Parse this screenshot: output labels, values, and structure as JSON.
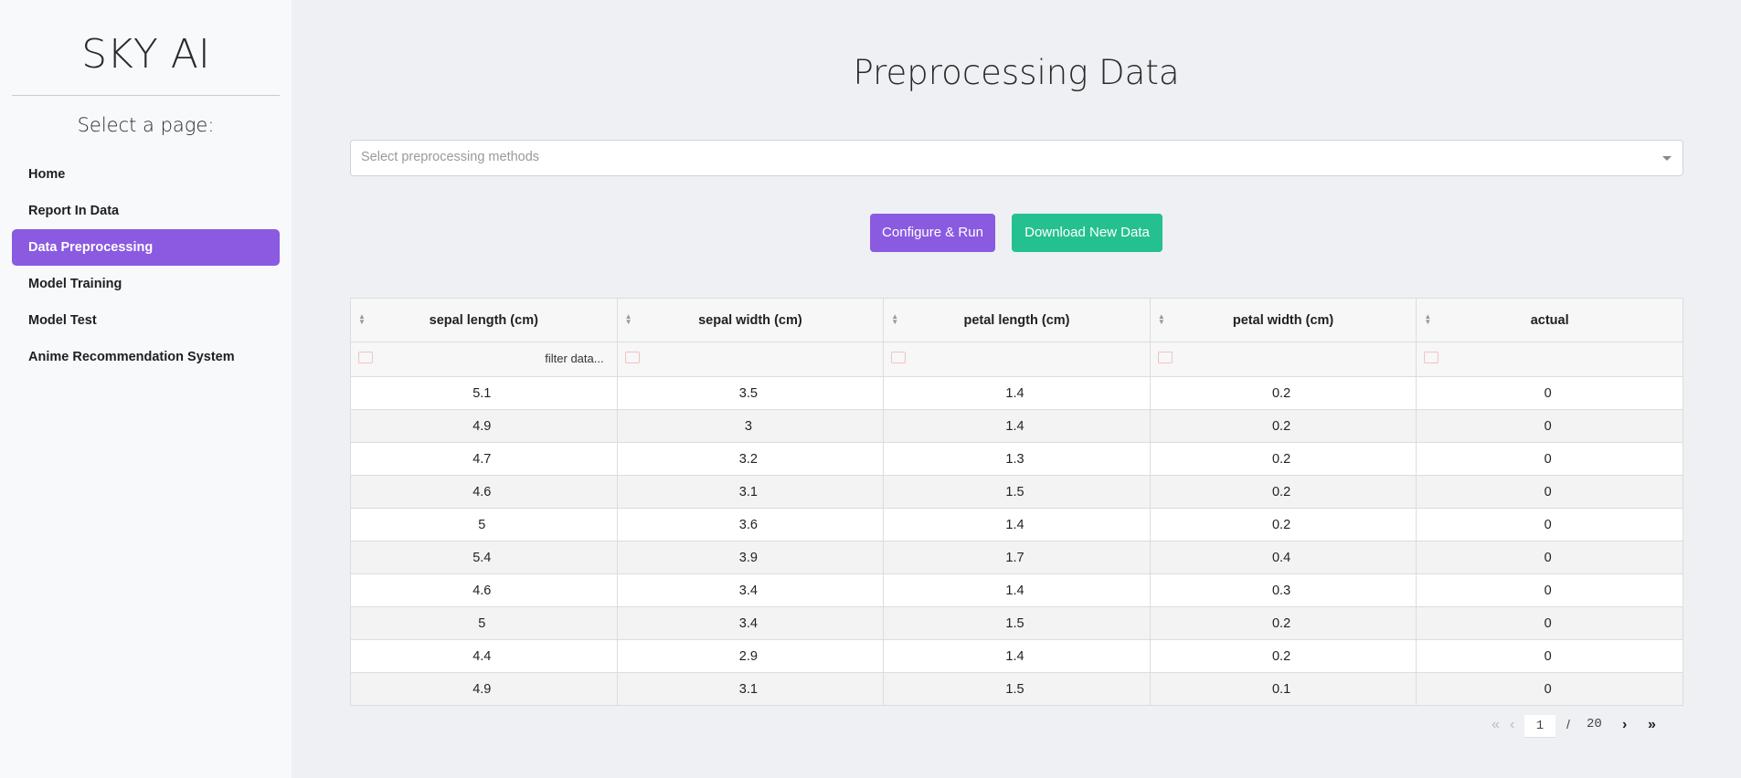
{
  "sidebar": {
    "brand": "SKY AI",
    "select_label": "Select a page:",
    "items": [
      {
        "label": "Home"
      },
      {
        "label": "Report In Data"
      },
      {
        "label": "Data Preprocessing"
      },
      {
        "label": "Model Training"
      },
      {
        "label": "Model Test"
      },
      {
        "label": "Anime Recommendation System"
      }
    ],
    "active_item": "Data Preprocessing"
  },
  "main": {
    "title": "Preprocessing Data",
    "select_placeholder": "Select preprocessing methods",
    "run_button": "Configure & Run",
    "download_button": "Download New Data",
    "colors": {
      "accent": "#8a5ae0",
      "download": "#25c08f"
    }
  },
  "table": {
    "columns": [
      "sepal length (cm)",
      "sepal width (cm)",
      "petal length (cm)",
      "petal width (cm)",
      "actual"
    ],
    "filter_placeholder": "filter data...",
    "rows": [
      [
        "5.1",
        "3.5",
        "1.4",
        "0.2",
        "0"
      ],
      [
        "4.9",
        "3",
        "1.4",
        "0.2",
        "0"
      ],
      [
        "4.7",
        "3.2",
        "1.3",
        "0.2",
        "0"
      ],
      [
        "4.6",
        "3.1",
        "1.5",
        "0.2",
        "0"
      ],
      [
        "5",
        "3.6",
        "1.4",
        "0.2",
        "0"
      ],
      [
        "5.4",
        "3.9",
        "1.7",
        "0.4",
        "0"
      ],
      [
        "4.6",
        "3.4",
        "1.4",
        "0.3",
        "0"
      ],
      [
        "5",
        "3.4",
        "1.5",
        "0.2",
        "0"
      ],
      [
        "4.4",
        "2.9",
        "1.4",
        "0.2",
        "0"
      ],
      [
        "4.9",
        "3.1",
        "1.5",
        "0.1",
        "0"
      ]
    ]
  },
  "pagination": {
    "current_page": "1",
    "separator": "/",
    "total_pages": "20",
    "first_icon": "double-chevron-left-icon",
    "prev_icon": "chevron-left-icon",
    "next_icon": "chevron-right-icon",
    "last_icon": "double-chevron-right-icon"
  }
}
